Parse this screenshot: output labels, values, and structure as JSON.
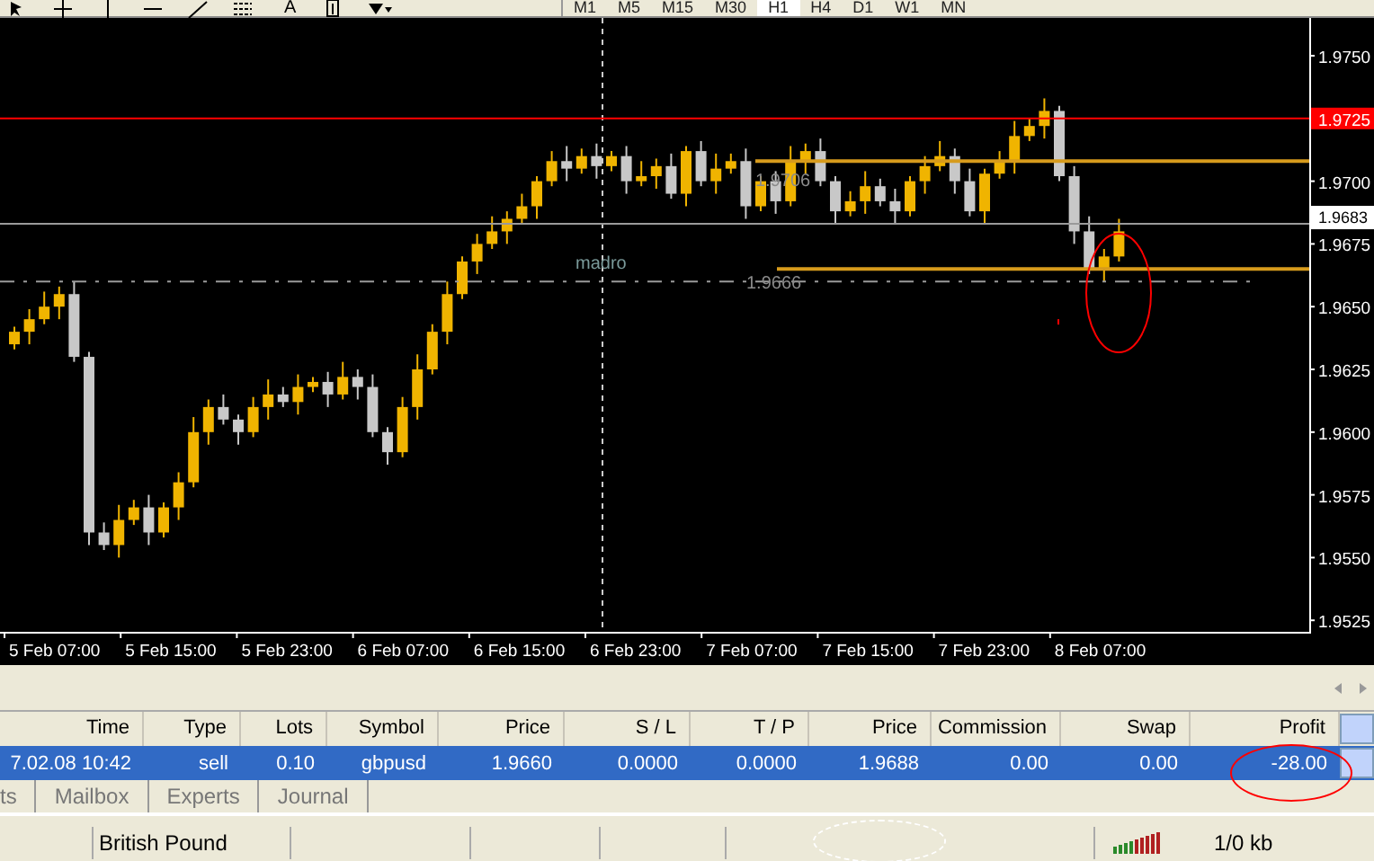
{
  "toolbar": {
    "tools": [
      {
        "kind": "cursor"
      },
      {
        "kind": "crosshair"
      },
      {
        "kind": "vline"
      },
      {
        "kind": "hline"
      },
      {
        "kind": "trend"
      },
      {
        "kind": "fibo"
      },
      {
        "kind": "text",
        "label": "A"
      },
      {
        "kind": "label"
      },
      {
        "kind": "arrows"
      }
    ],
    "timeframes": [
      {
        "label": "M1",
        "selected": false
      },
      {
        "label": "M5",
        "selected": false
      },
      {
        "label": "M15",
        "selected": false
      },
      {
        "label": "M30",
        "selected": false
      },
      {
        "label": "H1",
        "selected": true
      },
      {
        "label": "H4",
        "selected": false
      },
      {
        "label": "D1",
        "selected": false
      },
      {
        "label": "W1",
        "selected": false
      },
      {
        "label": "MN",
        "selected": false
      }
    ]
  },
  "chart": {
    "price_labels": [
      {
        "text": "1.9750",
        "highlighted": false
      },
      {
        "text": "1.9725",
        "highlighted": true
      },
      {
        "text": "1.9700",
        "highlighted": false
      },
      {
        "text": "1.9675",
        "highlighted": false
      },
      {
        "text": "1.9650",
        "highlighted": false
      },
      {
        "text": "1.9625",
        "highlighted": false
      },
      {
        "text": "1.9600",
        "highlighted": false
      },
      {
        "text": "1.9575",
        "highlighted": false
      },
      {
        "text": "1.9550",
        "highlighted": false
      },
      {
        "text": "1.9525",
        "highlighted": false
      }
    ],
    "bid_label": "1.9683",
    "time_labels": [
      "5 Feb 07:00",
      "5 Feb 15:00",
      "5 Feb 23:00",
      "6 Feb 07:00",
      "6 Feb 15:00",
      "6 Feb 23:00",
      "7 Feb 07:00",
      "7 Feb 15:00",
      "7 Feb 23:00",
      "8 Feb 07:00"
    ],
    "line_labels": [
      "madro",
      "1.9706",
      "1.9666"
    ]
  },
  "trades": {
    "columns": [
      "Time",
      "Type",
      "Lots",
      "Symbol",
      "Price",
      "S / L",
      "T / P",
      "Price",
      "Commission",
      "Swap",
      "Profit"
    ],
    "rows": [
      {
        "selected": true,
        "cells": [
          "7.02.08 10:42",
          "sell",
          "0.10",
          "gbpusd",
          "1.9660",
          "0.0000",
          "0.0000",
          "1.9688",
          "0.00",
          "0.00",
          "-28.00"
        ]
      }
    ]
  },
  "tabs": [
    {
      "label": "ts",
      "selected": false
    },
    {
      "label": "Mailbox",
      "selected": false
    },
    {
      "label": "Experts",
      "selected": false
    },
    {
      "label": "Journal",
      "selected": false
    }
  ],
  "status_bar": {
    "symbol": "British Pound",
    "traffic": "1/0 kb"
  }
}
